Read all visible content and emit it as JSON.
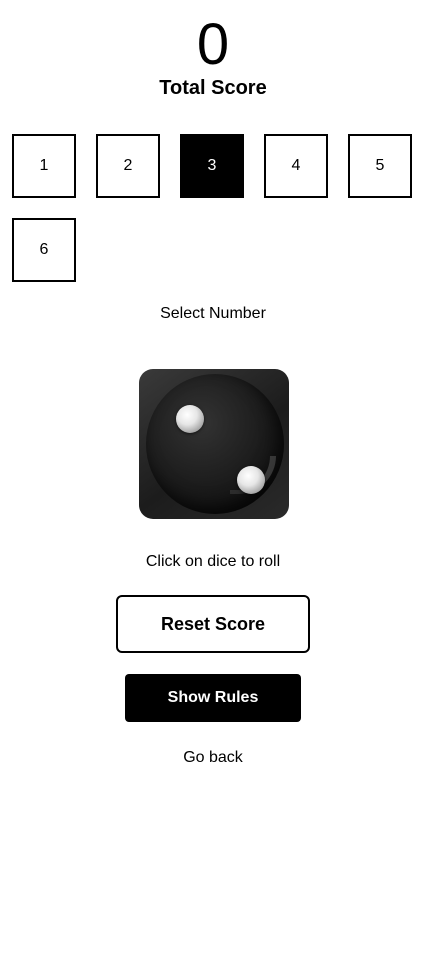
{
  "score": {
    "value": "0",
    "label": "Total Score"
  },
  "numbers": {
    "options": [
      "1",
      "2",
      "3",
      "4",
      "5",
      "6"
    ],
    "selected": "3",
    "label": "Select Number"
  },
  "dice": {
    "face_value": 2,
    "hint": "Click on dice to roll"
  },
  "actions": {
    "reset_label": "Reset Score",
    "rules_label": "Show Rules",
    "back_label": "Go back"
  }
}
